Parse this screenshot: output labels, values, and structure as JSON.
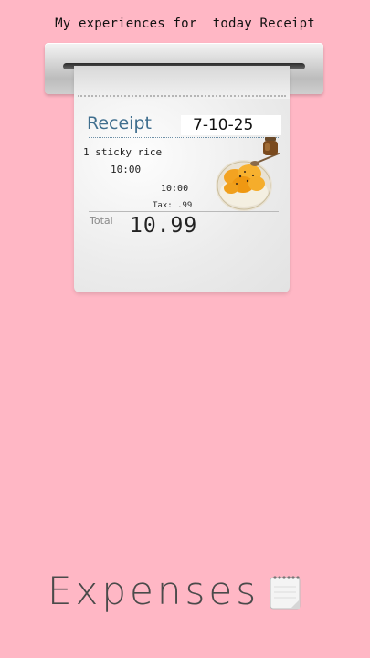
{
  "header": {
    "title": "My experiences for  today Receipt"
  },
  "receipt": {
    "title": "Receipt",
    "date": "7-10-25",
    "item": "1 sticky rice",
    "item_time": "10:00",
    "subtotal_time": "10:00",
    "tax": "Tax: .99",
    "total_label": "Total",
    "total_value": "10.99"
  },
  "footer": {
    "label": "Expenses"
  },
  "icons": {
    "notepad": "notepad-icon",
    "food_photo": "mango-sticky-rice-photo",
    "jar_photo": "sauce-jar-photo"
  },
  "colors": {
    "background": "#ffb7c5",
    "receipt_title": "#3f6e8e"
  }
}
